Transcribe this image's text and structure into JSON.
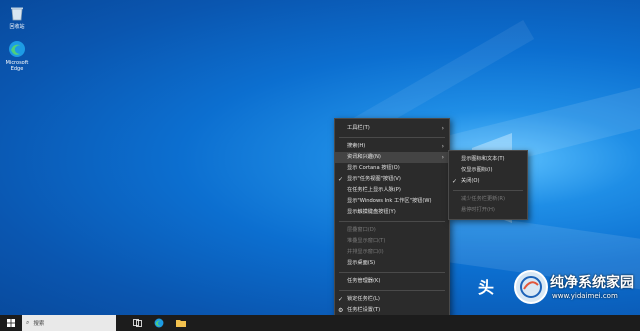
{
  "desktop": {
    "icons": [
      {
        "label": "回收站",
        "icon": "recycle-bin-icon"
      },
      {
        "label": "Microsoft Edge",
        "icon": "edge-icon"
      }
    ]
  },
  "context_menu": {
    "items": [
      {
        "label": "工具栏(T)",
        "submenu": true
      },
      {
        "label": "搜索(H)",
        "submenu": true
      },
      {
        "label": "资讯和兴趣(N)",
        "submenu": true,
        "highlight": true
      },
      {
        "label": "显示 Cortana 按钮(O)"
      },
      {
        "label": "显示\"任务视图\"按钮(V)",
        "checked": true
      },
      {
        "label": "在任务栏上显示人脉(P)"
      },
      {
        "label": "显示\"Windows Ink 工作区\"按钮(W)"
      },
      {
        "label": "显示触摸键盘按钮(Y)"
      },
      {
        "label": "层叠窗口(D)",
        "disabled": true
      },
      {
        "label": "堆叠显示窗口(T)",
        "disabled": true
      },
      {
        "label": "并排显示窗口(I)",
        "disabled": true
      },
      {
        "label": "显示桌面(S)"
      },
      {
        "label": "任务管理器(K)"
      },
      {
        "label": "锁定任务栏(L)",
        "checked": true
      },
      {
        "label": "任务栏设置(T)",
        "gear": true
      }
    ]
  },
  "submenu": {
    "items": [
      {
        "label": "显示图标和文本(T)"
      },
      {
        "label": "仅显示图标(I)"
      },
      {
        "label": "关闭(O)",
        "checked": true
      },
      {
        "label": "减少任务栏更新(R)",
        "disabled": true
      },
      {
        "label": "悬停时打开(H)",
        "disabled": true
      }
    ]
  },
  "taskbar": {
    "search_placeholder": "搜索"
  },
  "watermark": {
    "brand_left": "头",
    "title": "纯净系统家园",
    "url": "www.yidaimei.com"
  }
}
